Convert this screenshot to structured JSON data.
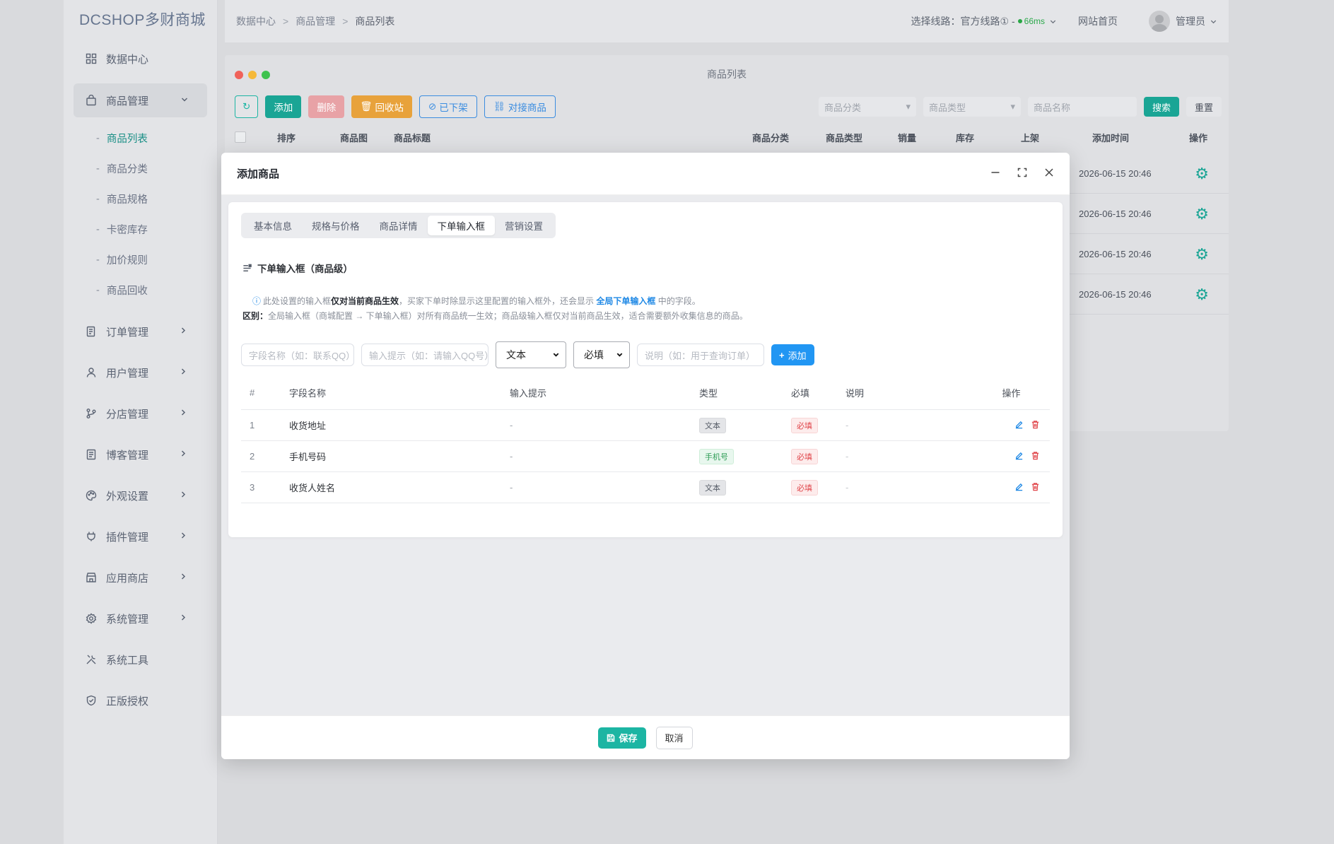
{
  "app": {
    "logo": "DCSHOP多财商城"
  },
  "sidebar": {
    "items": [
      {
        "label": "数据中心",
        "icon": "dashboard-icon"
      },
      {
        "label": "商品管理",
        "icon": "bag-icon",
        "open": true
      },
      {
        "label": "订单管理",
        "icon": "order-icon"
      },
      {
        "label": "用户管理",
        "icon": "user-icon"
      },
      {
        "label": "分店管理",
        "icon": "branch-icon"
      },
      {
        "label": "博客管理",
        "icon": "blog-icon"
      },
      {
        "label": "外观设置",
        "icon": "palette-icon"
      },
      {
        "label": "插件管理",
        "icon": "plugin-icon"
      },
      {
        "label": "应用商店",
        "icon": "store-icon"
      },
      {
        "label": "系统管理",
        "icon": "gear-icon"
      },
      {
        "label": "系统工具",
        "icon": "tools-icon"
      },
      {
        "label": "正版授权",
        "icon": "shield-icon"
      }
    ],
    "sub_items": [
      "商品列表",
      "商品分类",
      "商品规格",
      "卡密库存",
      "加价规则",
      "商品回收"
    ],
    "active_sub": "商品列表"
  },
  "topbar": {
    "breadcrumb": [
      "数据中心",
      "商品管理",
      "商品列表"
    ],
    "route_label": "选择线路：官方线路① -",
    "latency": "66ms",
    "home_link": "网站首页",
    "user": "管理员"
  },
  "background_page": {
    "title": "商品列表",
    "toolbar": {
      "refresh": "↻",
      "add": "添加",
      "delete": "删除",
      "recycle": "回收站",
      "offline": "已下架",
      "dock": "对接商品"
    },
    "filters": {
      "category": "商品分类",
      "type": "商品类型",
      "name_placeholder": "商品名称",
      "search": "搜索",
      "reset": "重置"
    },
    "columns": [
      "排序",
      "商品图",
      "商品标题",
      "商品分类",
      "商品类型",
      "销量",
      "库存",
      "上架",
      "添加时间",
      "操作"
    ],
    "rows": [
      {
        "time": "2026-06-15 20:46"
      },
      {
        "time": "2026-06-15 20:46"
      },
      {
        "time": "2026-06-15 20:46"
      },
      {
        "time": "2026-06-15 20:46"
      }
    ]
  },
  "modal": {
    "title": "添加商品",
    "tabs": [
      "基本信息",
      "规格与价格",
      "商品详情",
      "下单输入框",
      "营销设置"
    ],
    "active_tab": "下单输入框",
    "section_title": "下单输入框（商品级）",
    "note": {
      "line1_pre": "此处设置的输入框",
      "line1_bold": "仅对当前商品生效",
      "line1_mid": "，买家下单时除显示这里配置的输入框外，还会显示 ",
      "line1_link": "全局下单输入框",
      "line1_post": " 中的字段。",
      "line2_bold": "区别：",
      "line2_text": "全局输入框（商城配置 → 下单输入框）对所有商品统一生效；商品级输入框仅对当前商品生效，适合需要额外收集信息的商品。"
    },
    "form": {
      "field_name_placeholder": "字段名称（如：联系QQ）",
      "hint_placeholder": "输入提示（如：请输入QQ号）",
      "type_value": "文本",
      "required_value": "必填",
      "desc_placeholder": "说明（如：用于查询订单）",
      "add_button": "添加"
    },
    "table": {
      "columns": [
        "#",
        "字段名称",
        "输入提示",
        "类型",
        "必填",
        "说明",
        "操作"
      ],
      "rows": [
        {
          "num": "1",
          "name": "收货地址",
          "hint": "-",
          "type": "文本",
          "type_color": "gray",
          "required": "必填",
          "desc": "-"
        },
        {
          "num": "2",
          "name": "手机号码",
          "hint": "-",
          "type": "手机号",
          "type_color": "green",
          "required": "必填",
          "desc": "-"
        },
        {
          "num": "3",
          "name": "收货人姓名",
          "hint": "-",
          "type": "文本",
          "type_color": "gray",
          "required": "必填",
          "desc": "-"
        }
      ]
    },
    "footer": {
      "save": "保存",
      "cancel": "取消"
    }
  },
  "colors": {
    "accent": "#1cb5a3",
    "primary_blue": "#2196f3",
    "danger": "#e0454a"
  }
}
